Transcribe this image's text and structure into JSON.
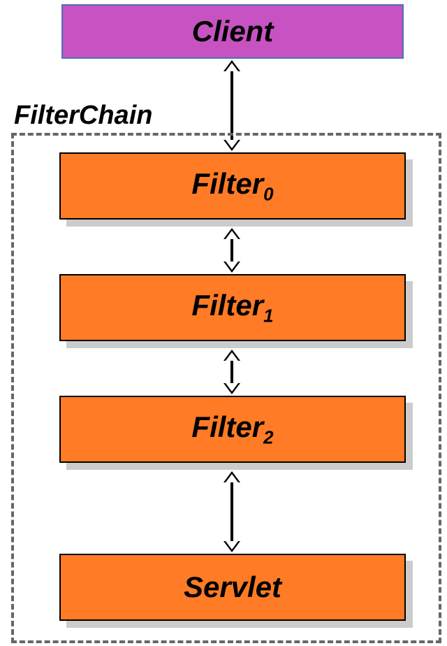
{
  "client": {
    "label": "Client"
  },
  "filterChain": {
    "label": "FilterChain"
  },
  "boxes": {
    "filter0": {
      "name": "Filter",
      "sub": "0"
    },
    "filter1": {
      "name": "Filter",
      "sub": "1"
    },
    "filter2": {
      "name": "Filter",
      "sub": "2"
    },
    "servlet": {
      "name": "Servlet"
    }
  },
  "colors": {
    "client_fill": "#c753c3",
    "client_border": "#4a6fb8",
    "filter_fill": "#ff7b26",
    "shadow": "#cccccc",
    "dash_border": "#666666"
  }
}
